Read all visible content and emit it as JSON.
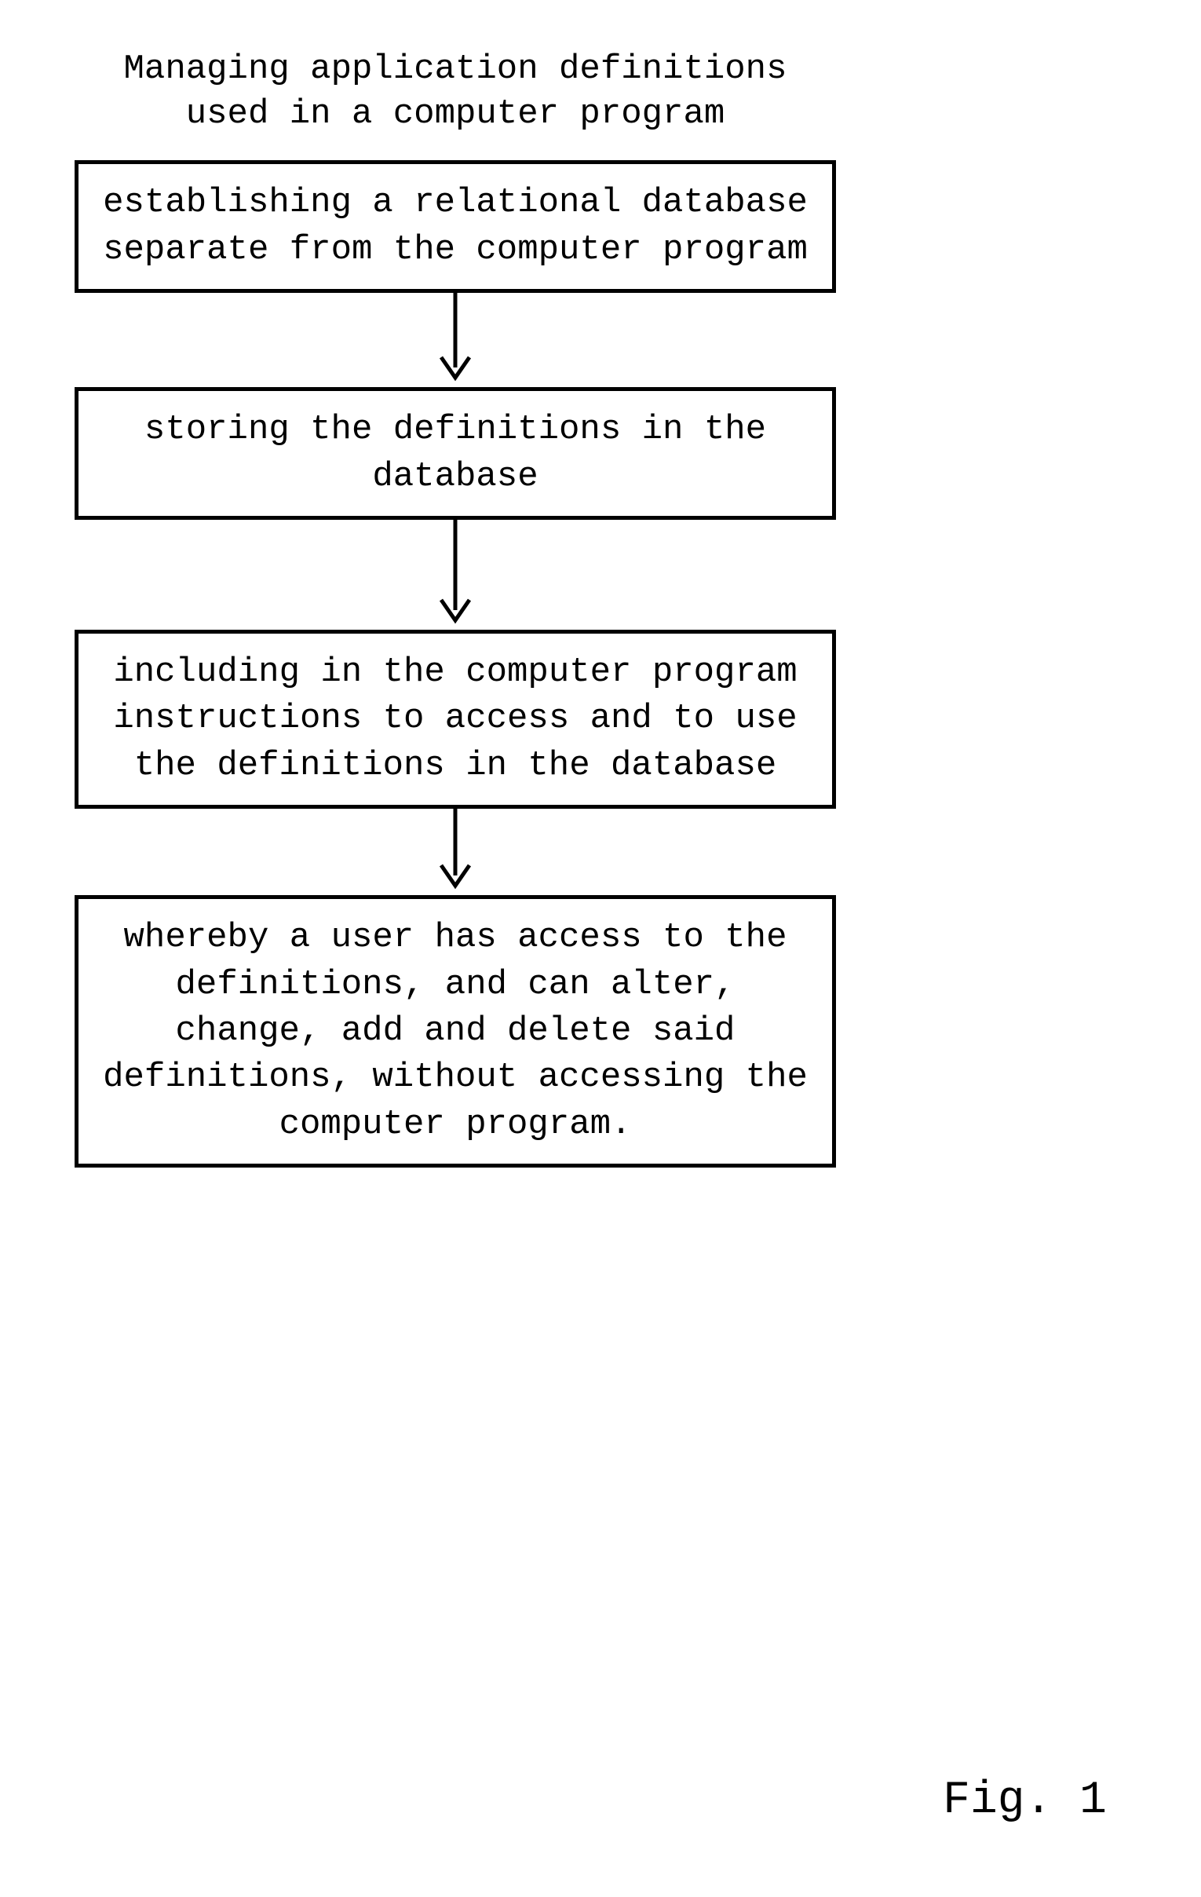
{
  "title_line1": "Managing application definitions",
  "title_line2": "used in a computer program",
  "boxes": [
    "establishing a relational database separate from the computer program",
    "storing the definitions in the database",
    "including in the computer program instructions to access and to use the definitions in the database",
    "whereby a user has access to the definitions, and can alter, change, add and delete said definitions, without accessing the computer program."
  ],
  "figure_label": "Fig. 1"
}
